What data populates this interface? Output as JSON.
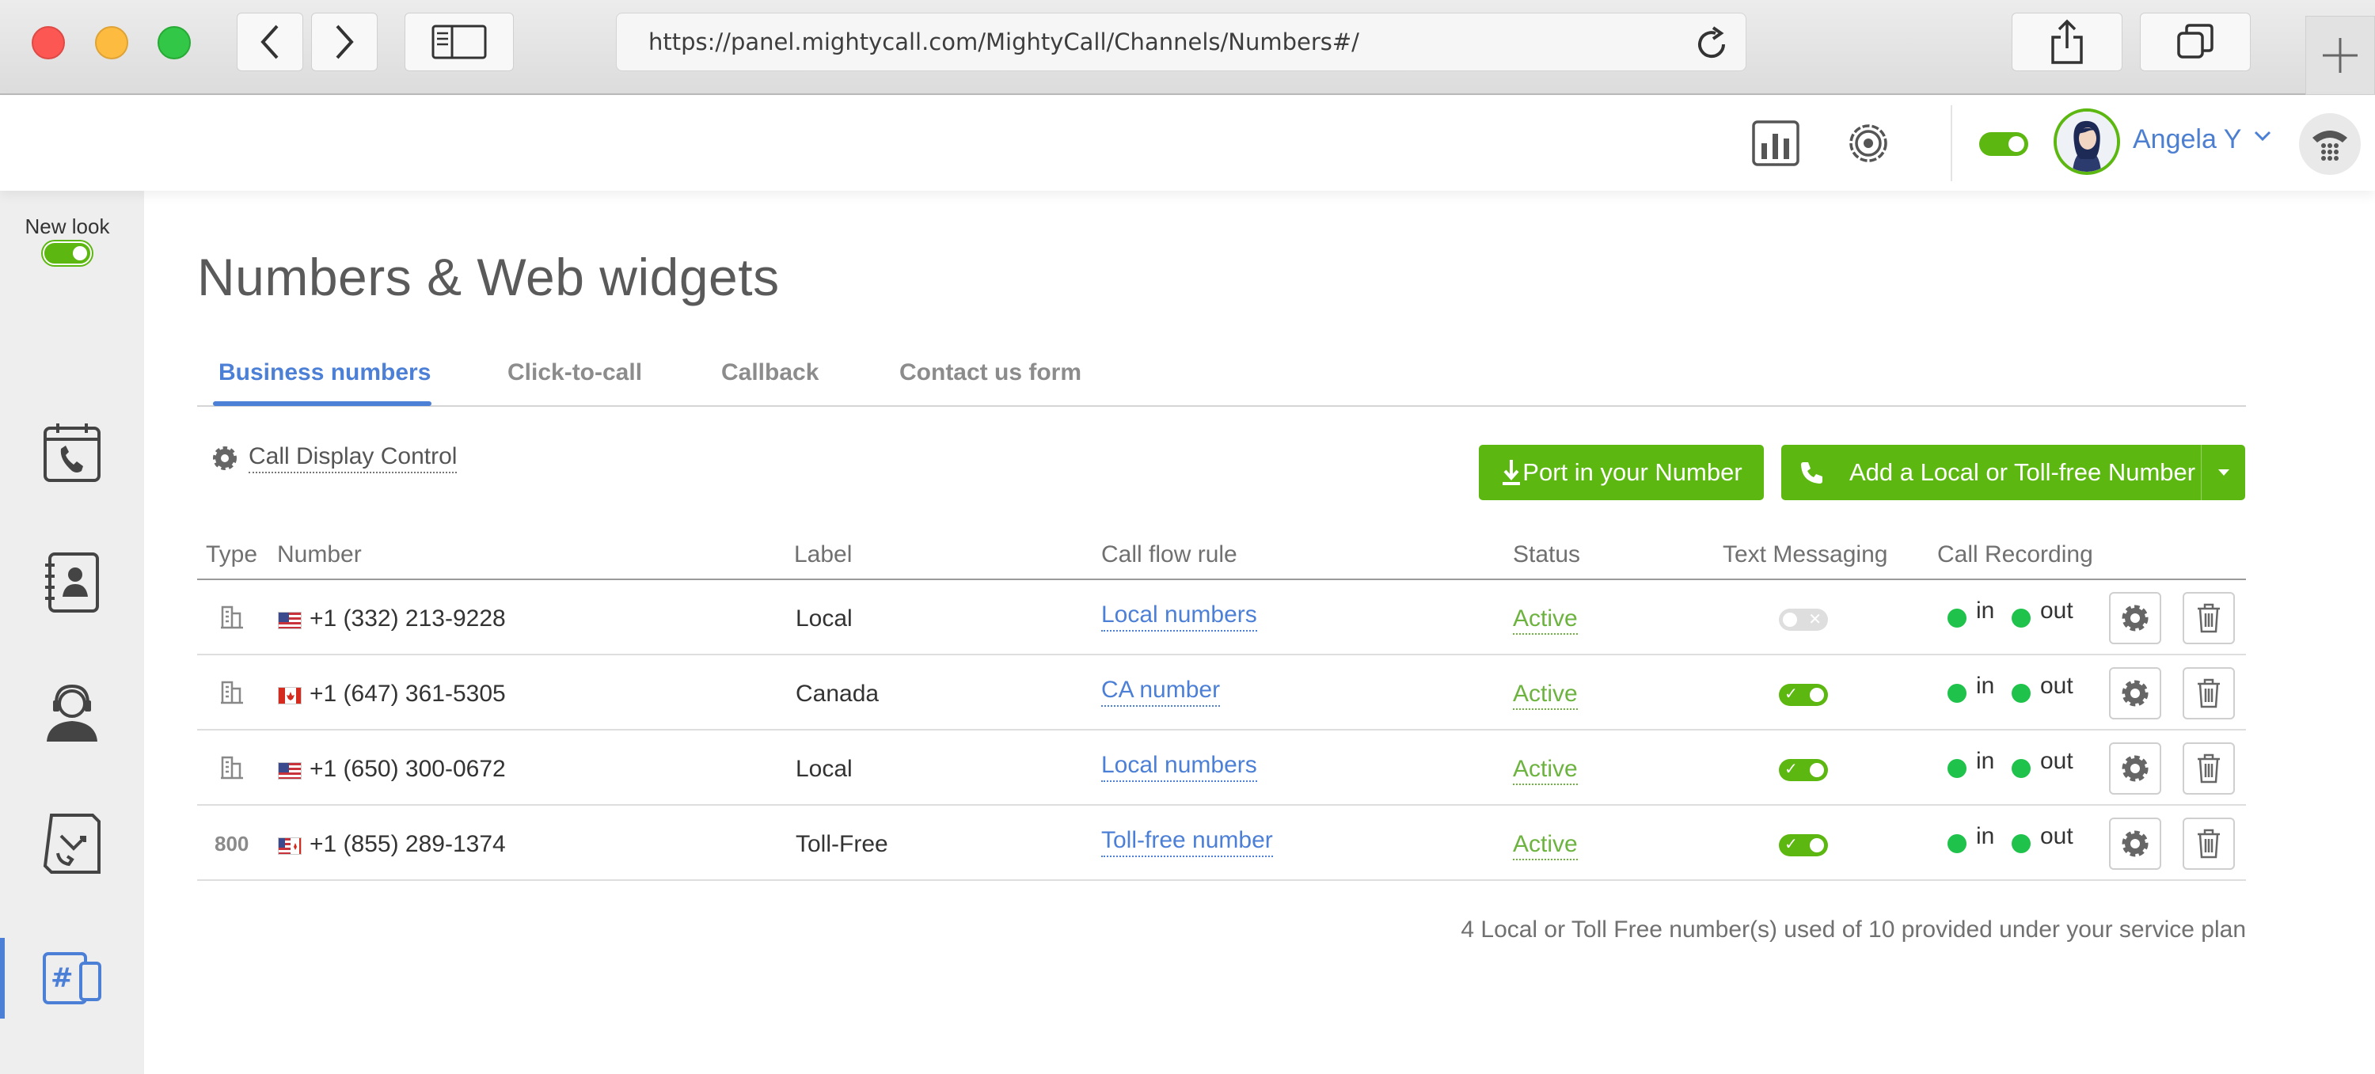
{
  "browser": {
    "url": "https://panel.mightycall.com/MightyCall/Channels/Numbers#/"
  },
  "header": {
    "user_name": "Angela Y"
  },
  "sidebar": {
    "new_look_label": "New look"
  },
  "page": {
    "title": "Numbers & Web widgets",
    "tabs": [
      {
        "label": "Business numbers",
        "active": true
      },
      {
        "label": "Click-to-call",
        "active": false
      },
      {
        "label": "Callback",
        "active": false
      },
      {
        "label": "Contact us form",
        "active": false
      }
    ],
    "call_display_control": "Call Display Control",
    "port_button": "Port in your Number",
    "add_button": "Add a Local or Toll-free Number"
  },
  "table": {
    "columns": [
      "Type",
      "Number",
      "Label",
      "Call flow rule",
      "Status",
      "Text Messaging",
      "Call Recording"
    ],
    "rows": [
      {
        "type": "local",
        "type_text": "",
        "country": "us",
        "number": "+1 (332) 213-9228",
        "label": "Local",
        "call_flow_rule": "Local numbers",
        "status": "Active",
        "text_messaging": false,
        "rec_in": "in",
        "rec_out": "out"
      },
      {
        "type": "local",
        "type_text": "",
        "country": "ca",
        "number": "+1 (647) 361-5305",
        "label": "Canada",
        "call_flow_rule": "CA number",
        "status": "Active",
        "text_messaging": true,
        "rec_in": "in",
        "rec_out": "out"
      },
      {
        "type": "local",
        "type_text": "",
        "country": "us",
        "number": "+1 (650) 300-0672",
        "label": "Local",
        "call_flow_rule": "Local numbers",
        "status": "Active",
        "text_messaging": true,
        "rec_in": "in",
        "rec_out": "out"
      },
      {
        "type": "toll-free",
        "type_text": "800",
        "country": "us-ca",
        "number": "+1 (855) 289-1374",
        "label": "Toll-Free",
        "call_flow_rule": "Toll-free number",
        "status": "Active",
        "text_messaging": true,
        "rec_in": "in",
        "rec_out": "out"
      }
    ]
  },
  "footer": {
    "usage_note": "4 Local or Toll Free number(s) used of 10 provided under your service plan"
  },
  "colors": {
    "accent_green": "#5cb811",
    "accent_blue": "#4c7fd6",
    "recording_dot": "#1fc24a"
  }
}
